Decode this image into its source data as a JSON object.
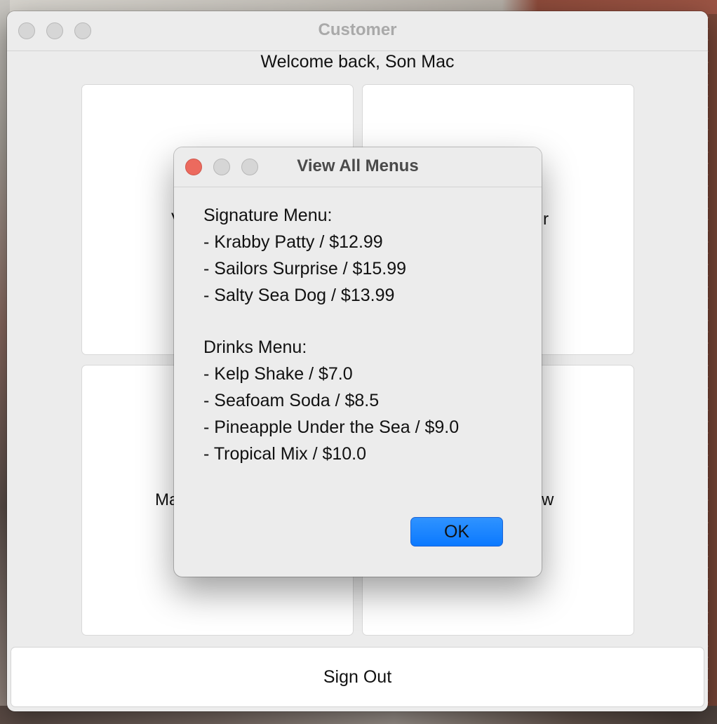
{
  "window": {
    "title": "Customer"
  },
  "welcome": "Welcome back, Son Mac",
  "tiles": [
    {
      "label_fragment_left": "V",
      "label_fragment_right": "r"
    },
    {
      "label_fragment_left": "Ma",
      "label_fragment_right": "w"
    }
  ],
  "signout_label": "Sign Out",
  "dialog": {
    "title": "View All Menus",
    "signature_header": "Signature Menu:",
    "signature_items": [
      "- Krabby Patty / $12.99",
      "- Sailors Surprise / $15.99",
      "- Salty Sea Dog / $13.99"
    ],
    "drinks_header": "Drinks Menu:",
    "drinks_items": [
      "- Kelp Shake / $7.0",
      "- Seafoam Soda / $8.5",
      "- Pineapple Under the Sea / $9.0",
      "- Tropical Mix / $10.0"
    ],
    "ok_label": "OK"
  },
  "colors": {
    "close_button": "#ec6a5e",
    "ok_button": "#0b79ff",
    "window_bg": "#ececec"
  }
}
